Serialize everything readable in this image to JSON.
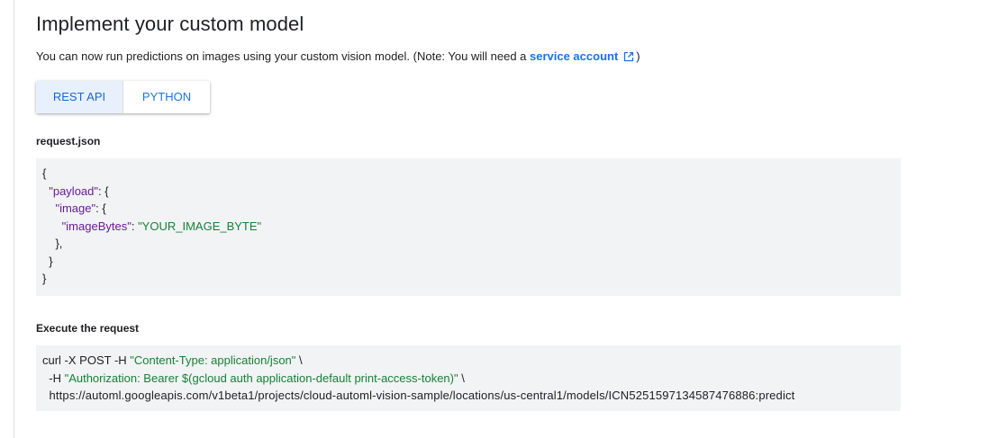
{
  "page": {
    "title": "Implement your custom model",
    "intro_text": "You can now run predictions on images using your custom vision model. (Note: You will need a ",
    "intro_link": "service account",
    "intro_tail": ")"
  },
  "tabs": [
    {
      "label": "REST API",
      "selected": true
    },
    {
      "label": "PYTHON",
      "selected": false
    }
  ],
  "request_section": {
    "label": "request.json",
    "lines": {
      "l1": "{",
      "l2_key": "\"payload\"",
      "l2_rest": ": {",
      "l3_key": "\"image\"",
      "l3_rest": ": {",
      "l4_key": "\"imageBytes\"",
      "l4_sep": ": ",
      "l4_val": "\"YOUR_IMAGE_BYTE\"",
      "l5": "},",
      "l6": "}",
      "l7": "}"
    }
  },
  "execute_section": {
    "label": "Execute the request",
    "lines": {
      "l1_cmd": "curl -X POST -H ",
      "l1_str": "\"Content-Type: application/json\"",
      "l1_tail": " \\",
      "l2_cmd": "-H ",
      "l2_str": "\"Authorization: Bearer $(gcloud auth application-default print-access-token)\"",
      "l2_tail": " \\",
      "l3_url": "https://automl.googleapis.com/v1beta1/projects/cloud-automl-vision-sample/locations/us-central1/models/ICN5251597134587476886:predict"
    }
  },
  "colors": {
    "accent": "#1a73e8",
    "tab_selected_bg": "#e8f0fe",
    "code_bg": "#f1f3f4",
    "json_key": "#6a1b9a",
    "json_string": "#188038"
  },
  "icons": {
    "external_link": "open-in-new-icon"
  }
}
